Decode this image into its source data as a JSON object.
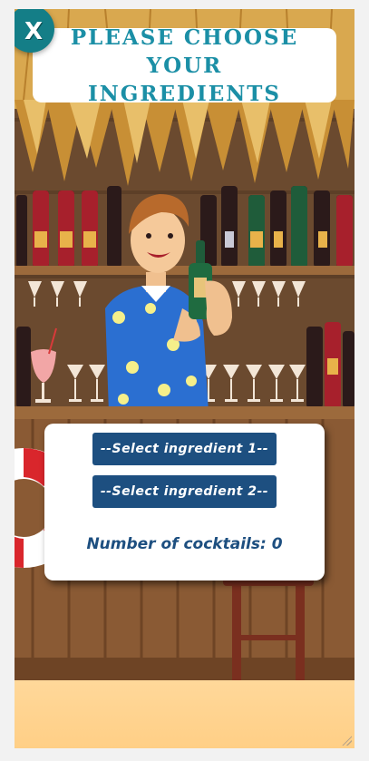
{
  "close": {
    "label": "X"
  },
  "header": {
    "title": "Please choose your ingredients"
  },
  "selects": [
    {
      "label": "--Select ingredient 1--"
    },
    {
      "label": "--Select ingredient 2--"
    }
  ],
  "counter": {
    "label": "Number of cocktails:",
    "value": "0",
    "text": "Number of cocktails: 0"
  },
  "colors": {
    "title": "#1b8fa6",
    "button": "#1d4f80",
    "close": "#147e87",
    "thatch": "#d9a84f",
    "wall": "#6b4a2f",
    "counter": "#8a5a34"
  },
  "icons": [
    "close-icon",
    "bartender-illustration",
    "life-ring",
    "cocktail-glass",
    "bar-stool"
  ]
}
